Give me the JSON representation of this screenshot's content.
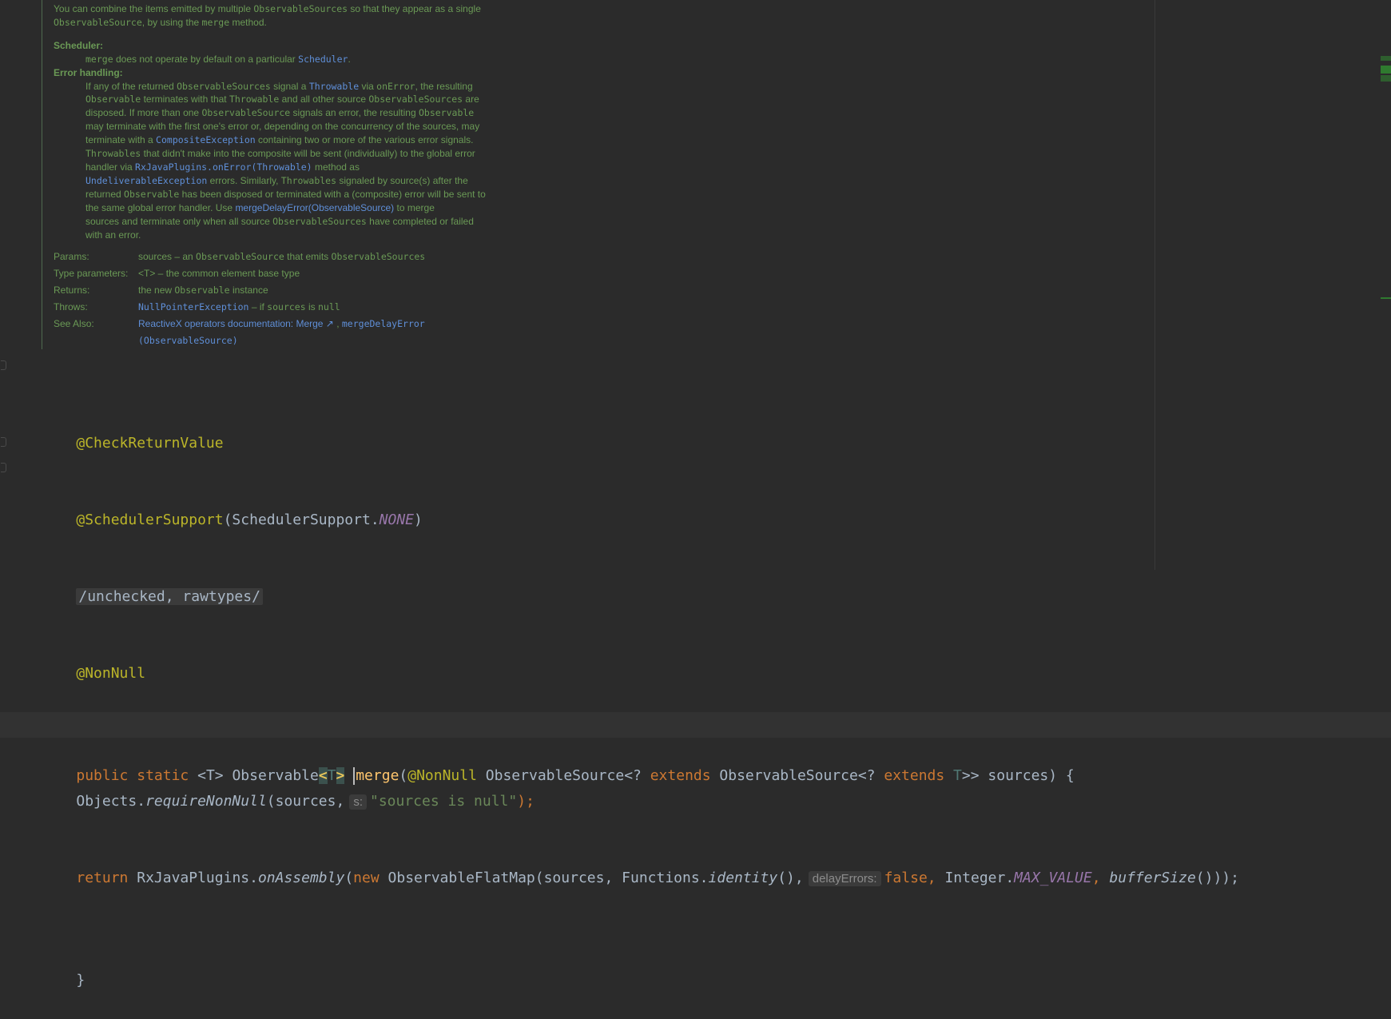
{
  "doc": {
    "intro_a": "You can combine the items emitted by multiple",
    "intro_code1": "ObservableSources",
    "intro_b": "so that they appear as a single",
    "intro_code2": "ObservableSource",
    "intro_c": ", by using the",
    "intro_code3": "merge",
    "intro_d": "method.",
    "scheduler_label": "Scheduler:",
    "scheduler_code": "merge",
    "scheduler_text": "does not operate by default on a particular",
    "scheduler_link": "Scheduler",
    "scheduler_end": ".",
    "error_label": "Error handling:",
    "error_lines": [
      [
        "If any of the returned ",
        "c:ObservableSources",
        " signal a ",
        "l:Throwable",
        " via ",
        "c:onError",
        ", the resulting"
      ],
      [
        "c:Observable",
        " terminates with that ",
        "c:Throwable",
        " and all other source ",
        "c:ObservableSources",
        " are"
      ],
      [
        "disposed. If more than one ",
        "c:ObservableSource",
        " signals an error, the resulting ",
        "c:Observable"
      ],
      [
        "may terminate with the first one's error or, depending on the concurrency of the sources, may"
      ],
      [
        "terminate with a ",
        "l:CompositeException",
        " containing two or more of the various error signals."
      ],
      [
        "c:Throwables",
        " that didn't make into the composite will be sent (individually) to the global error"
      ],
      [
        "handler via ",
        "l:RxJavaPlugins.onError(Throwable)",
        " method as"
      ],
      [
        "l:UndeliverableException",
        " errors. Similarly, ",
        "c:Throwables",
        " signaled by source(s) after the"
      ],
      [
        "returned ",
        "c:Observable",
        " has been disposed or terminated with a (composite) error will be sent to"
      ],
      [
        "the same global error handler. Use ",
        "l:mergeDelayError(ObservableSource)",
        " to merge"
      ],
      [
        "sources and terminate only when all source ",
        "c:ObservableSources",
        " have completed or failed"
      ],
      [
        "with an error."
      ]
    ],
    "tags": [
      {
        "name": "Params:",
        "parts": [
          "sources – an ",
          "c:ObservableSource",
          " that emits ",
          "c:ObservableSources"
        ]
      },
      {
        "name": "Type parameters:",
        "parts": [
          "<T> – the common element base type"
        ]
      },
      {
        "name": "Returns:",
        "parts": [
          "the new ",
          "c:Observable",
          " instance"
        ]
      },
      {
        "name": "Throws:",
        "parts": [
          "l:NullPointerException",
          " – if ",
          "c:sources",
          " is ",
          "c:null"
        ]
      },
      {
        "name": "See Also:",
        "parts": [
          "l:ReactiveX operators documentation: Merge ↗",
          " , ",
          "lc:mergeDelayError"
        ]
      },
      {
        "name": "",
        "parts": [
          "lc:(ObservableSource)"
        ]
      }
    ]
  },
  "code": {
    "line1": "@CheckReturnValue",
    "line2_ann": "@SchedulerSupport",
    "line2_open": "(SchedulerSupport.",
    "line2_const": "NONE",
    "line2_close": ")",
    "line3_folded": "/unchecked, rawtypes/",
    "line4": "@NonNull",
    "line5": {
      "public": "public",
      "static": "static",
      "generic": "<T>",
      "ret": "Observable",
      "lt": "<",
      "T": "T",
      "gt": ">",
      "method": "merge",
      "paren": "(",
      "nonnull": "@NonNull",
      "type1": "ObservableSource<?",
      "extends1": "extends",
      "type2": "ObservableSource<?",
      "extends2": "extends",
      "T2": "T",
      "rest": ">> sources) {"
    },
    "line6": {
      "obj": "Objects.",
      "method": "requireNonNull",
      "args": "(sources,",
      "hint": "s:",
      "str": "\"sources is null\"",
      "end": ");"
    },
    "line7": {
      "return": "return",
      "cls": "RxJavaPlugins.",
      "method": "onAssembly",
      "open": "(",
      "new": "new",
      "ctor": "ObservableFlatMap(sources,",
      "fn": "Functions.",
      "identity": "identity",
      "after_identity": "(),",
      "hint": "delayErrors:",
      "false": "false,",
      "integer": "Integer.",
      "max": "MAX_VALUE",
      "comma": ",",
      "buf": "bufferSize",
      "end": "()));"
    },
    "line8": "}"
  }
}
